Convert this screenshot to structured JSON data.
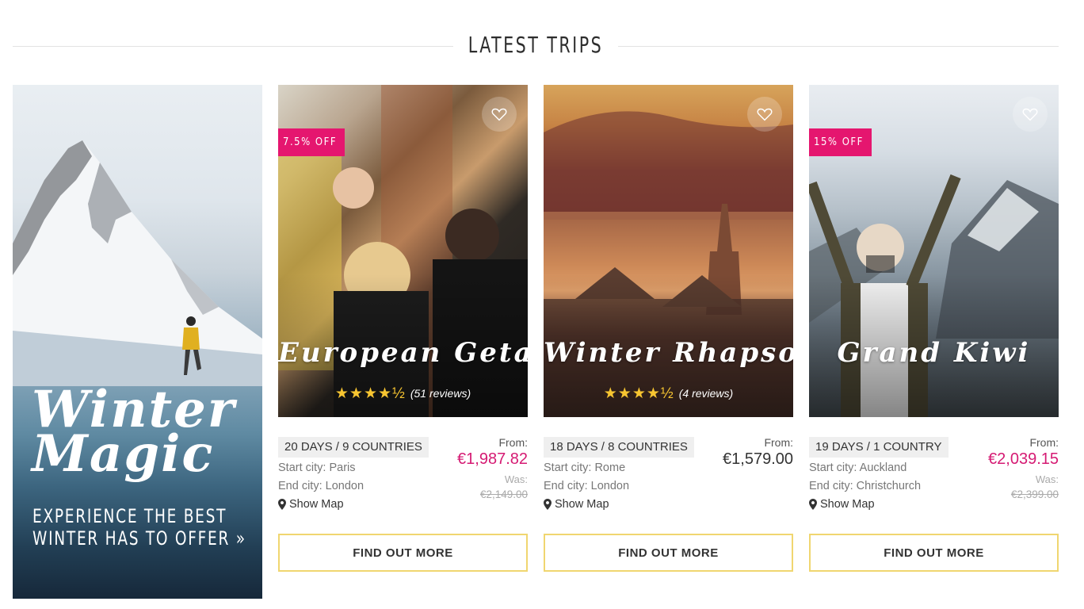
{
  "section": {
    "title": "LATEST TRIPS"
  },
  "promo": {
    "title_line1": "Winter",
    "title_line2": "Magic",
    "subtitle_line1": "EXPERIENCE THE BEST",
    "subtitle_line2": "WINTER HAS TO OFFER »"
  },
  "colors": {
    "accent_pink": "#e5166f",
    "sale_price": "#d51a73",
    "cta_border": "#f0d670",
    "star": "#f7c531"
  },
  "labels": {
    "from": "From:",
    "was": "Was:",
    "show_map": "Show Map",
    "cta": "FIND OUT MORE"
  },
  "trips": [
    {
      "name": "European Getaway",
      "badge": "7.5% OFF",
      "rating": 4.5,
      "stars": "★★★★½",
      "reviews": "(51 reviews)",
      "duration": "20 DAYS / 9 COUNTRIES",
      "start_city": "Start city: Paris",
      "end_city": "End city: London",
      "price": "€1,987.82",
      "was_price": "€2,149.00"
    },
    {
      "name": "Winter Rhapsody",
      "rating": 4.5,
      "stars": "★★★★½",
      "reviews": "(4 reviews)",
      "duration": "18 DAYS / 8 COUNTRIES",
      "start_city": "Start city: Rome",
      "end_city": "End city: London",
      "price": "€1,579.00"
    },
    {
      "name": "Grand Kiwi",
      "badge": "15% OFF",
      "duration": "19 DAYS / 1 COUNTRY",
      "start_city": "Start city: Auckland",
      "end_city": "End city: Christchurch",
      "price": "€2,039.15",
      "was_price": "€2,399.00"
    }
  ],
  "icons": {
    "favorite": "heart-icon",
    "map": "map-marker-icon",
    "rating": "star-icon"
  }
}
